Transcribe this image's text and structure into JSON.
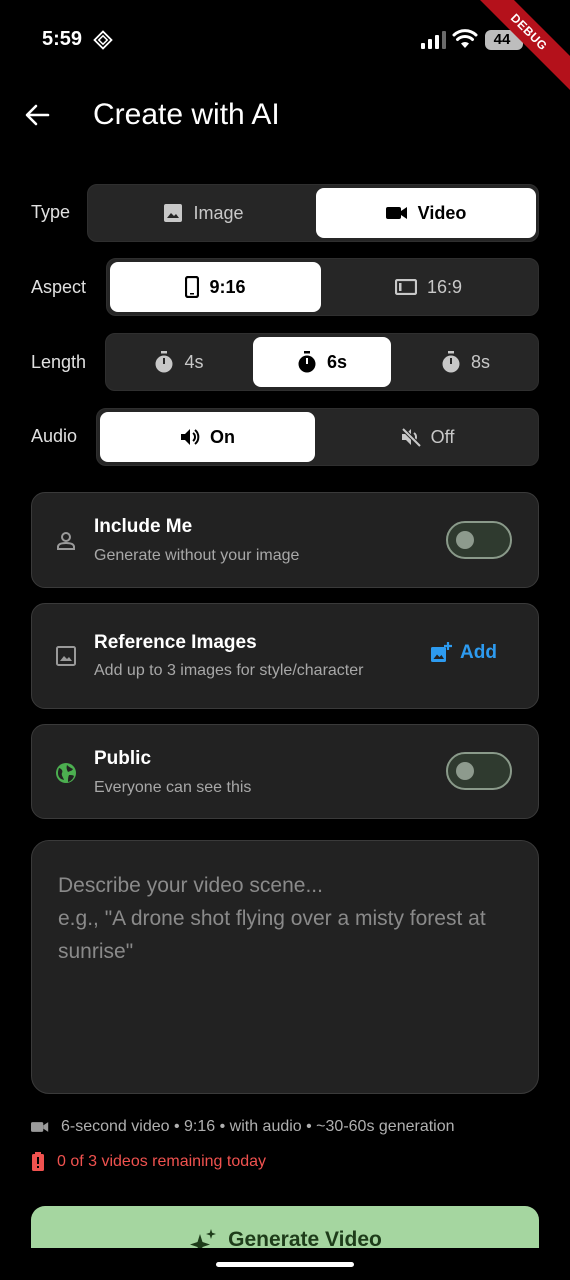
{
  "status_bar": {
    "time": "5:59",
    "battery": "44"
  },
  "debug_label": "DEBUG",
  "header": {
    "title": "Create with AI",
    "back_icon": "arrow-left-icon"
  },
  "type_row": {
    "label": "Type",
    "options": [
      {
        "label": "Image",
        "icon": "image-icon",
        "selected": false
      },
      {
        "label": "Video",
        "icon": "videocam-icon",
        "selected": true
      }
    ]
  },
  "aspect_row": {
    "label": "Aspect",
    "options": [
      {
        "label": "9:16",
        "icon": "phone-portrait-icon",
        "selected": true
      },
      {
        "label": "16:9",
        "icon": "landscape-frame-icon",
        "selected": false
      }
    ]
  },
  "length_row": {
    "label": "Length",
    "options": [
      {
        "label": "4s",
        "icon": "timer-icon",
        "selected": false
      },
      {
        "label": "6s",
        "icon": "timer-icon",
        "selected": true
      },
      {
        "label": "8s",
        "icon": "timer-icon",
        "selected": false
      }
    ]
  },
  "audio_row": {
    "label": "Audio",
    "options": [
      {
        "label": "On",
        "icon": "volume-up-icon",
        "selected": true
      },
      {
        "label": "Off",
        "icon": "volume-off-icon",
        "selected": false
      }
    ]
  },
  "include_me": {
    "title": "Include Me",
    "subtitle": "Generate without your image",
    "enabled": false
  },
  "reference_images": {
    "title": "Reference Images",
    "subtitle": "Add up to 3 images for style/character",
    "add_label": "Add"
  },
  "public": {
    "title": "Public",
    "subtitle": "Everyone can see this",
    "enabled": false
  },
  "prompt": {
    "placeholder": "Describe your video scene...\ne.g., \"A drone shot flying over a misty forest at sunrise\""
  },
  "summary": "6-second video • 9:16 • with audio • ~30-60s generation",
  "quota": "0 of 3 videos remaining today",
  "generate_button": {
    "label": "Generate Video"
  },
  "colors": {
    "accent_blue": "#2d9bf0",
    "public_green": "#4caf50",
    "warning_red": "#f0524f",
    "generate_bg": "#a5d6a0"
  }
}
